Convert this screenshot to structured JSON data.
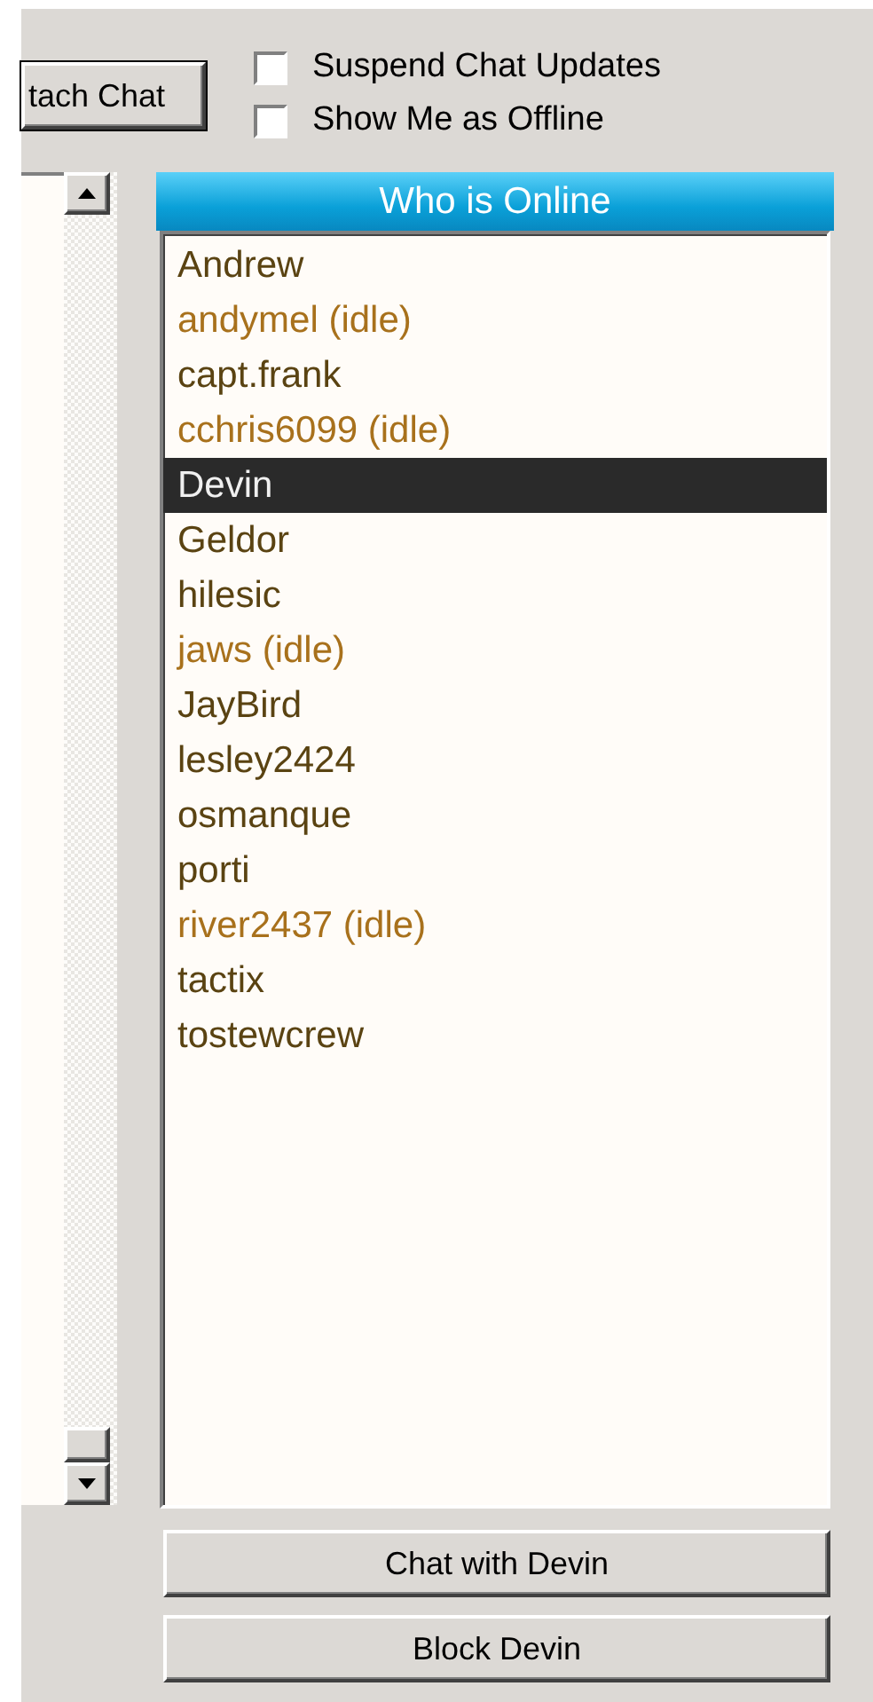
{
  "detach_button": {
    "label": "tach Chat"
  },
  "options": [
    {
      "label": "Suspend Chat Updates",
      "checked": false
    },
    {
      "label": "Show Me as Offline",
      "checked": false
    }
  ],
  "online_list": {
    "title": "Who is Online",
    "users": [
      {
        "name": "Andrew",
        "idle": false,
        "selected": false
      },
      {
        "name": "andymel (idle)",
        "idle": true,
        "selected": false
      },
      {
        "name": "capt.frank",
        "idle": false,
        "selected": false
      },
      {
        "name": "cchris6099 (idle)",
        "idle": true,
        "selected": false
      },
      {
        "name": "Devin",
        "idle": false,
        "selected": true
      },
      {
        "name": "Geldor",
        "idle": false,
        "selected": false
      },
      {
        "name": "hilesic",
        "idle": false,
        "selected": false
      },
      {
        "name": "jaws (idle)",
        "idle": true,
        "selected": false
      },
      {
        "name": "JayBird",
        "idle": false,
        "selected": false
      },
      {
        "name": "lesley2424",
        "idle": false,
        "selected": false
      },
      {
        "name": "osmanque",
        "idle": false,
        "selected": false
      },
      {
        "name": "porti",
        "idle": false,
        "selected": false
      },
      {
        "name": "river2437 (idle)",
        "idle": true,
        "selected": false
      },
      {
        "name": "tactix",
        "idle": false,
        "selected": false
      },
      {
        "name": "tostewcrew",
        "idle": false,
        "selected": false
      }
    ]
  },
  "buttons": [
    {
      "label": "Chat with Devin"
    },
    {
      "label": "Block Devin"
    }
  ]
}
